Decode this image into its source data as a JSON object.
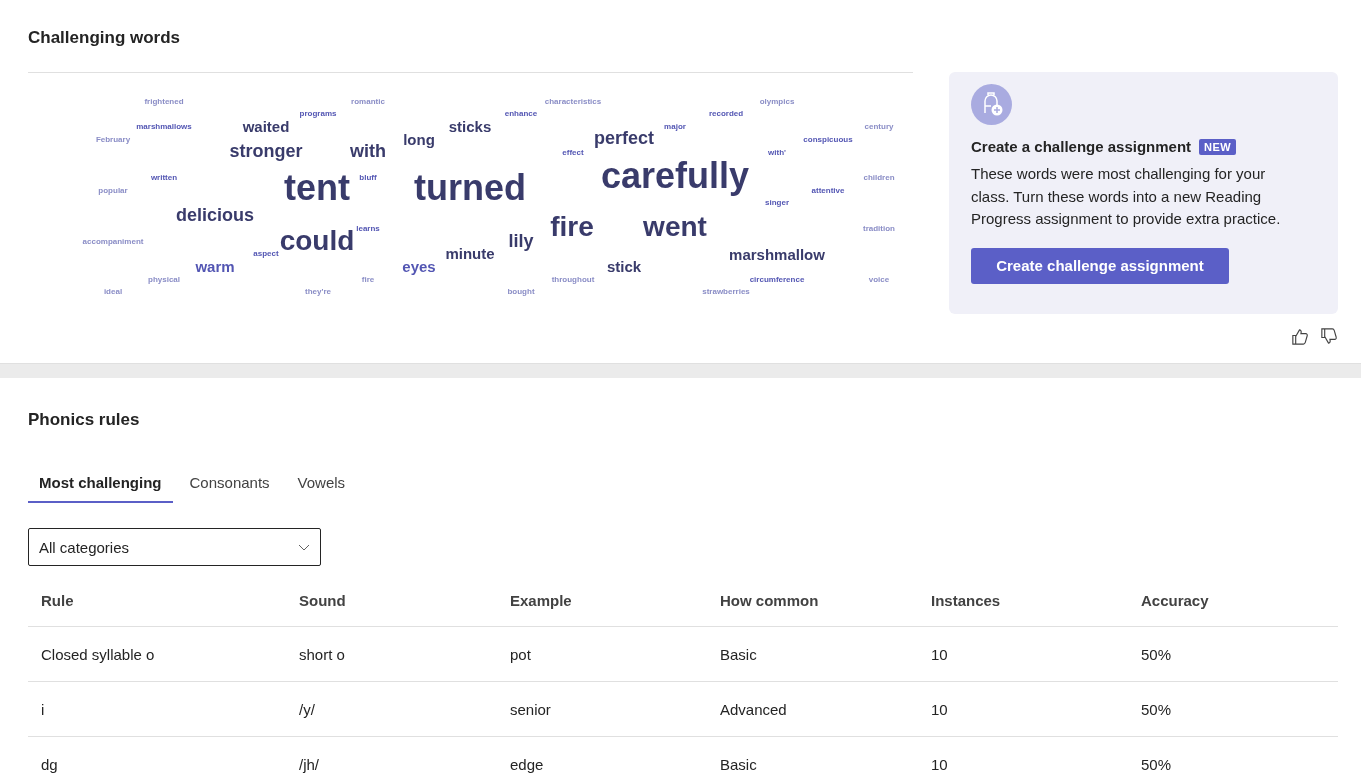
{
  "challenging_words": {
    "title": "Challenging words",
    "words": [
      {
        "text": "frightened",
        "kind": "xs",
        "color": "#8a8dc6"
      },
      {
        "text": "romantic",
        "kind": "xs",
        "color": "#8a8dc6"
      },
      {
        "text": "characteristics",
        "kind": "xs",
        "color": "#8a8dc6"
      },
      {
        "text": "olympics",
        "kind": "xs",
        "color": "#8a8dc6"
      },
      {
        "text": "programs",
        "kind": "xs",
        "color": "#5356b3"
      },
      {
        "text": "enhance",
        "kind": "xs",
        "color": "#5356b3"
      },
      {
        "text": "recorded",
        "kind": "xs",
        "color": "#5356b3"
      },
      {
        "text": "marshmallows",
        "kind": "xs",
        "color": "#5356b3"
      },
      {
        "text": "waited",
        "kind": "md",
        "color": "#393b6b"
      },
      {
        "text": "sticks",
        "kind": "md",
        "color": "#393b6b"
      },
      {
        "text": "major",
        "kind": "xs",
        "color": "#5356b3"
      },
      {
        "text": "century",
        "kind": "xs",
        "color": "#8a8dc6"
      },
      {
        "text": "February",
        "kind": "xs",
        "color": "#8a8dc6"
      },
      {
        "text": "long",
        "kind": "md",
        "color": "#393b6b"
      },
      {
        "text": "perfect",
        "kind": "lg",
        "color": "#393b6b"
      },
      {
        "text": "conspicuous",
        "kind": "xs",
        "color": "#5356b3"
      },
      {
        "text": "stronger",
        "kind": "lg",
        "color": "#393b6b"
      },
      {
        "text": "with",
        "kind": "lg",
        "color": "#393b6b"
      },
      {
        "text": "effect",
        "kind": "xs",
        "color": "#5356b3"
      },
      {
        "text": "with'",
        "kind": "xs",
        "color": "#5356b3"
      },
      {
        "text": "written",
        "kind": "xs",
        "color": "#5356b3"
      },
      {
        "text": "bluff",
        "kind": "xs",
        "color": "#5356b3"
      },
      {
        "text": "carefully",
        "kind": "xxl",
        "color": "#393b6b"
      },
      {
        "text": "children",
        "kind": "xs",
        "color": "#8a8dc6"
      },
      {
        "text": "popular",
        "kind": "xs",
        "color": "#8a8dc6"
      },
      {
        "text": "tent",
        "kind": "xxl",
        "color": "#393b6b"
      },
      {
        "text": "turned",
        "kind": "xxl",
        "color": "#393b6b"
      },
      {
        "text": "attentive",
        "kind": "xs",
        "color": "#5356b3"
      },
      {
        "text": "singer",
        "kind": "xs",
        "color": "#5356b3"
      },
      {
        "text": "delicious",
        "kind": "lg",
        "color": "#393b6b"
      },
      {
        "text": "learns",
        "kind": "xs",
        "color": "#5356b3"
      },
      {
        "text": "fire",
        "kind": "xl",
        "color": "#393b6b"
      },
      {
        "text": "went",
        "kind": "xl",
        "color": "#393b6b"
      },
      {
        "text": "tradition",
        "kind": "xs",
        "color": "#8a8dc6"
      },
      {
        "text": "accompaniment",
        "kind": "xs",
        "color": "#8a8dc6"
      },
      {
        "text": "could",
        "kind": "xl",
        "color": "#393b6b"
      },
      {
        "text": "lily",
        "kind": "lg",
        "color": "#393b6b"
      },
      {
        "text": "aspect",
        "kind": "xs",
        "color": "#5356b3"
      },
      {
        "text": "minute",
        "kind": "md",
        "color": "#393b6b"
      },
      {
        "text": "marshmallow",
        "kind": "md",
        "color": "#393b6b"
      },
      {
        "text": "warm",
        "kind": "md",
        "color": "#5356b3"
      },
      {
        "text": "eyes",
        "kind": "md",
        "color": "#5356b3"
      },
      {
        "text": "stick",
        "kind": "md",
        "color": "#393b6b"
      },
      {
        "text": "physical",
        "kind": "xs",
        "color": "#8a8dc6"
      },
      {
        "text": "fire",
        "kind": "xs",
        "color": "#8a8dc6"
      },
      {
        "text": "throughout",
        "kind": "xs",
        "color": "#8a8dc6"
      },
      {
        "text": "circumference",
        "kind": "xs",
        "color": "#5356b3"
      },
      {
        "text": "voice",
        "kind": "xs",
        "color": "#8a8dc6"
      },
      {
        "text": "ideal",
        "kind": "xs",
        "color": "#8a8dc6"
      },
      {
        "text": "they're",
        "kind": "xs",
        "color": "#8a8dc6"
      },
      {
        "text": "bought",
        "kind": "xs",
        "color": "#8a8dc6"
      },
      {
        "text": "strawberries",
        "kind": "xs",
        "color": "#8a8dc6"
      }
    ],
    "card": {
      "title": "Create a challenge assignment",
      "badge": "NEW",
      "body": "These words were most challenging for your class. Turn these words into a new Reading Progress assignment to provide extra practice.",
      "button": "Create challenge assignment"
    }
  },
  "phonics_rules": {
    "title": "Phonics rules",
    "tabs": [
      {
        "label": "Most challenging",
        "selected": true
      },
      {
        "label": "Consonants",
        "selected": false
      },
      {
        "label": "Vowels",
        "selected": false
      }
    ],
    "dropdown": {
      "value": "All categories"
    },
    "table": {
      "columns": [
        "Rule",
        "Sound",
        "Example",
        "How common",
        "Instances",
        "Accuracy"
      ],
      "rows": [
        [
          "Closed syllable o",
          "short o",
          "pot",
          "Basic",
          "10",
          "50%"
        ],
        [
          "i",
          "/y/",
          "senior",
          "Advanced",
          "10",
          "50%"
        ],
        [
          "dg",
          "/jh/",
          "edge",
          "Basic",
          "10",
          "50%"
        ]
      ]
    }
  }
}
